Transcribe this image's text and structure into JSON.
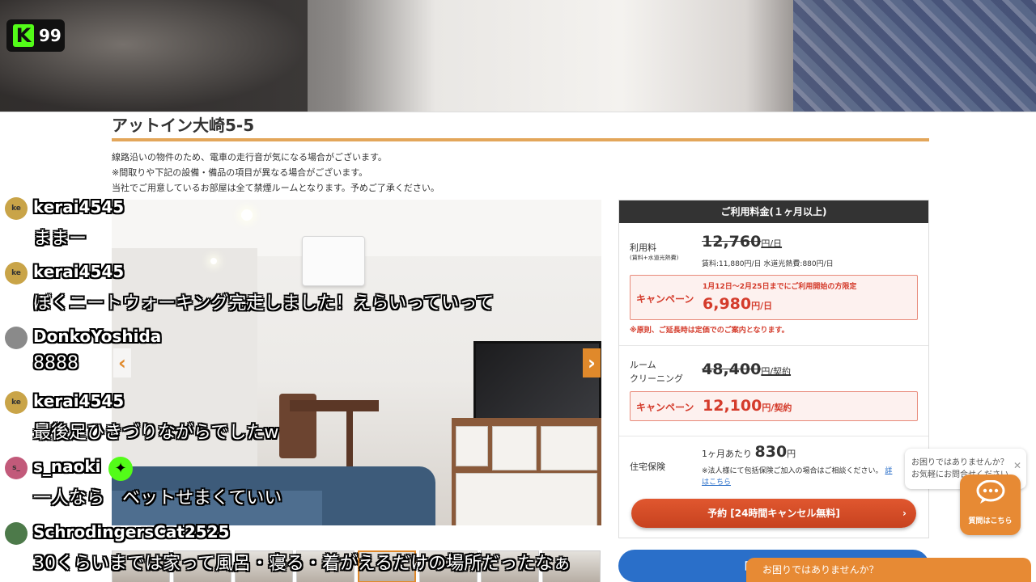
{
  "stream": {
    "viewer_count": "99",
    "logo_letter": "K"
  },
  "listing": {
    "title": "アットイン大崎5-5",
    "notes": [
      "線路沿いの物件のため、電車の走行音が気になる場合がございます。",
      "※間取りや下記の設備・備品の項目が異なる場合がございます。",
      "当社でご用意しているお部屋は全て禁煙ルームとなります。予めご了承ください。"
    ],
    "prev_arrow": "‹",
    "next_arrow": "›"
  },
  "pricing": {
    "header": "ご利用料金(１ヶ月以上)",
    "usage": {
      "label": "利用料",
      "sublabel": "(賃料+水道光熱費)",
      "regular_price": "12,760",
      "regular_unit": "円/日",
      "breakdown": "賃料:11,880円/日  水道光熱費:880円/日",
      "campaign_label": "キャンペーン",
      "campaign_period": "1月12日～2月25日までにご利用開始の方限定",
      "campaign_price": "6,980",
      "campaign_unit": "円/日",
      "note": "※原則、ご延長時は定価でのご案内となります。"
    },
    "cleaning": {
      "label_line1": "ルーム",
      "label_line2": "クリーニング",
      "regular_price": "48,400",
      "regular_unit": "円/契約",
      "campaign_label": "キャンペーン",
      "campaign_price": "12,100",
      "campaign_unit": "円/契約"
    },
    "insurance": {
      "label": "住宅保険",
      "prefix": "1ヶ月あたり",
      "price": "830",
      "unit": "円",
      "note": "※法人様にて包括保険ご加入の場合はご相談ください。",
      "link1": "詳",
      "link2": "はこちら"
    },
    "reserve_button": "予約 [24時間キャンセル無料]",
    "reserve_chevron": "›"
  },
  "same_building_button": "同じ建物の他",
  "help": {
    "bubble_line1": "お困りではありませんか？",
    "bubble_line2": "お気軽にお問合せください",
    "close": "✕",
    "button_label": "質問はこちら",
    "bar_text": "お困りではありませんか？"
  },
  "chat": [
    {
      "user": "kerai4545",
      "avatar": "ke",
      "avatar_color": "#c9a448",
      "text": "ままー"
    },
    {
      "user": "kerai4545",
      "avatar": "ke",
      "avatar_color": "#c9a448",
      "text": "ぼくニートウォーキング完走しました！えらいっていって"
    },
    {
      "user": "DonkoYoshida",
      "avatar": "",
      "avatar_color": "#8a8a8a",
      "text": "8888"
    },
    {
      "user": "kerai4545",
      "avatar": "ke",
      "avatar_color": "#c9a448",
      "text": "最後足ひきづりながらでしたw"
    },
    {
      "user": "s_naoki",
      "avatar": "s_",
      "avatar_color": "#c25a7a",
      "text": "一人なら　ベットせまくていい"
    },
    {
      "user": "SchrodingersCat2525",
      "avatar": "",
      "avatar_color": "#4d7a4a",
      "text": "30くらいまでは家って風呂・寝る・着がえるだけの場所だったなぁ"
    }
  ]
}
